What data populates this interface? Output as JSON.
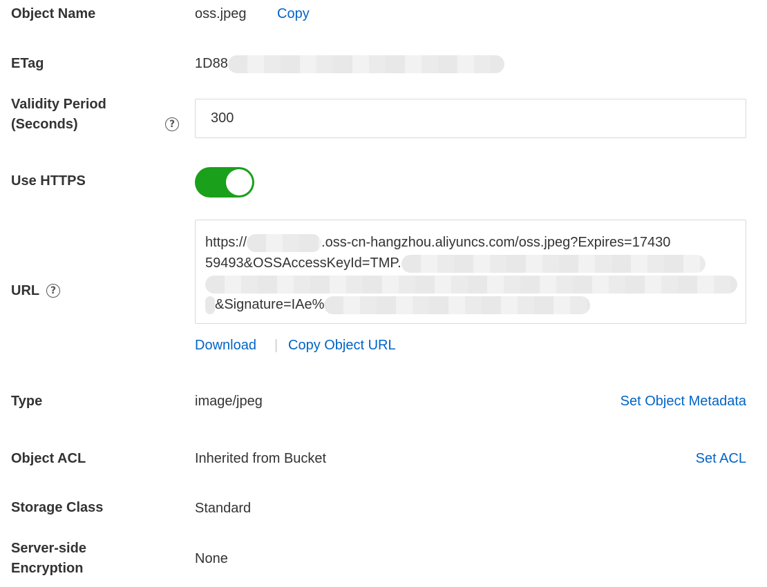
{
  "fields": {
    "object_name": {
      "label": "Object Name",
      "value": "oss.jpeg",
      "action": "Copy"
    },
    "etag": {
      "label": "ETag",
      "value_prefix": "1D88"
    },
    "validity": {
      "label_line1": "Validity Period",
      "label_line2": "(Seconds)",
      "value": "300"
    },
    "use_https": {
      "label": "Use HTTPS",
      "enabled": true
    },
    "url": {
      "label": "URL",
      "line1_prefix": "https://",
      "line1_suffix": ".oss-cn-hangzhou.aliyuncs.com/oss.jpeg?Expires=17430",
      "line2_prefix": "59493&OSSAccessKeyId=TMP.",
      "line4_text": "&Signature=IAe%"
    },
    "url_actions": {
      "download": "Download",
      "separator": "|",
      "copy_url": "Copy Object URL"
    },
    "type": {
      "label": "Type",
      "value": "image/jpeg",
      "action": "Set Object Metadata"
    },
    "acl": {
      "label": "Object ACL",
      "value": "Inherited from Bucket",
      "action": "Set ACL"
    },
    "storage_class": {
      "label": "Storage Class",
      "value": "Standard"
    },
    "encryption": {
      "label_line1": "Server-side",
      "label_line2": "Encryption",
      "value": "None"
    }
  },
  "icons": {
    "help": "?"
  },
  "colors": {
    "link": "#0064c8",
    "toggle_on": "#1aa01a"
  }
}
